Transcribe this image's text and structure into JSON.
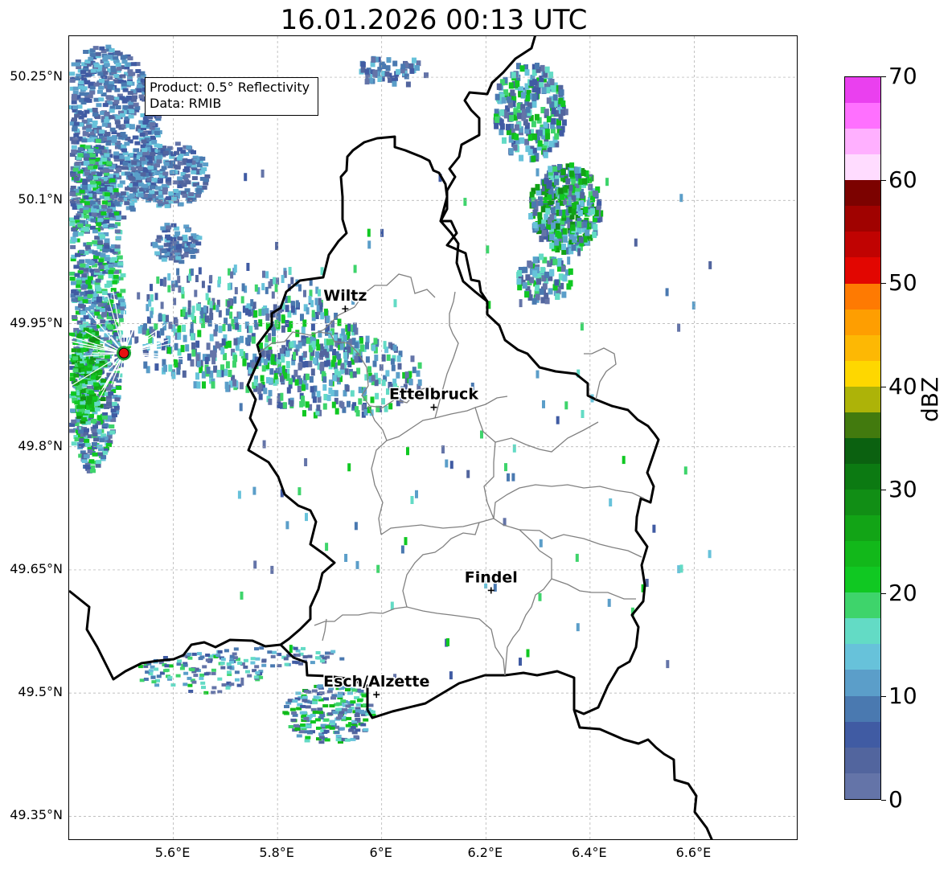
{
  "title": "16.01.2026 00:13 UTC",
  "info": {
    "product": "Product: 0.5° Reflectivity",
    "data": "Data: RMIB"
  },
  "map": {
    "lon_range": [
      5.4,
      6.8
    ],
    "lat_range": [
      49.32,
      50.3
    ],
    "lat_ticks": [
      {
        "value": 50.25,
        "label": "50.25°N"
      },
      {
        "value": 50.1,
        "label": "50.1°N"
      },
      {
        "value": 49.95,
        "label": "49.95°N"
      },
      {
        "value": 49.8,
        "label": "49.8°N"
      },
      {
        "value": 49.65,
        "label": "49.65°N"
      },
      {
        "value": 49.5,
        "label": "49.5°N"
      },
      {
        "value": 49.35,
        "label": "49.35°N"
      }
    ],
    "lon_ticks": [
      {
        "value": 5.6,
        "label": "5.6°E"
      },
      {
        "value": 5.8,
        "label": "5.8°E"
      },
      {
        "value": 6.0,
        "label": "6°E"
      },
      {
        "value": 6.2,
        "label": "6.2°E"
      },
      {
        "value": 6.4,
        "label": "6.4°E"
      },
      {
        "value": 6.6,
        "label": "6.6°E"
      }
    ],
    "cities": [
      {
        "name": "Wiltz",
        "lon": 5.93,
        "lat": 49.968
      },
      {
        "name": "Ettelbruck",
        "lon": 6.1,
        "lat": 49.848
      },
      {
        "name": "Findel",
        "lon": 6.21,
        "lat": 49.625
      },
      {
        "name": "Esch/Alzette",
        "lon": 5.99,
        "lat": 49.498
      }
    ],
    "radar_site": {
      "lon": 5.505,
      "lat": 49.914,
      "color": "#e8110f"
    }
  },
  "colorbar": {
    "label": "dBZ",
    "min": 0,
    "max": 70,
    "ticks": [
      0,
      10,
      20,
      30,
      40,
      50,
      60,
      70
    ],
    "colors": [
      "#6474a8",
      "#52659e",
      "#405ba3",
      "#4a79b0",
      "#5b9ec9",
      "#67c2da",
      "#63dbc5",
      "#3ed46b",
      "#10c822",
      "#12b81a",
      "#12a416",
      "#118e15",
      "#0c7a12",
      "#0b6110",
      "#427a0e",
      "#adb308",
      "#fed700",
      "#fdb804",
      "#fe9e01",
      "#fe7a02",
      "#e20601",
      "#c00302",
      "#a00200",
      "#7c0200",
      "#ffdcff",
      "#ffb0ff",
      "#ff70ff",
      "#ea40ef"
    ]
  }
}
